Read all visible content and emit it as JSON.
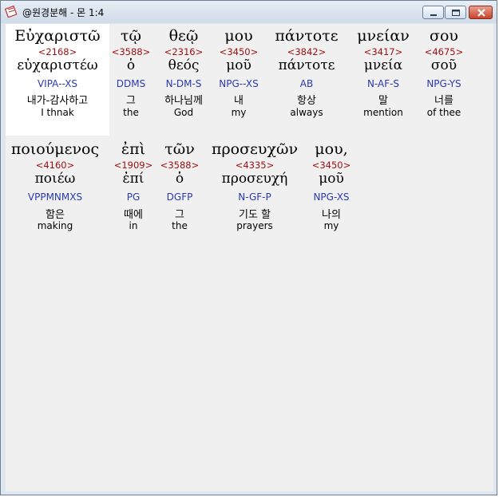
{
  "window": {
    "title": "@원경분해 - 몬 1:4",
    "icon": "bible-app-icon"
  },
  "rows": [
    [
      {
        "greek": "Εὐχαριστῶ",
        "number": "<2168>",
        "lemma": "εὐχαριστέω",
        "parsing": "VIPA--XS",
        "korean": "내가-감사하고",
        "english": "I thnak"
      },
      {
        "greek": "τῷ",
        "number": "<3588>",
        "lemma": "ὁ",
        "parsing": "DDMS",
        "korean": "그",
        "english": "the"
      },
      {
        "greek": "θεῷ",
        "number": "<2316>",
        "lemma": "θεός",
        "parsing": "N-DM-S",
        "korean": "하나님께",
        "english": "God"
      },
      {
        "greek": "μου",
        "number": "<3450>",
        "lemma": "μοῦ",
        "parsing": "NPG--XS",
        "korean": "내",
        "english": "my"
      },
      {
        "greek": "πάντοτε",
        "number": "<3842>",
        "lemma": "πάντοτε",
        "parsing": "AB",
        "korean": "항상",
        "english": "always"
      },
      {
        "greek": "μνείαν",
        "number": "<3417>",
        "lemma": "μνεία",
        "parsing": "N-AF-S",
        "korean": "말",
        "english": "mention"
      },
      {
        "greek": "σου",
        "number": "<4675>",
        "lemma": "σοῦ",
        "parsing": "NPG-YS",
        "korean": "너를",
        "english": "of thee"
      }
    ],
    [
      {
        "greek": "ποιούμενος",
        "number": "<4160>",
        "lemma": "ποιέω",
        "parsing": "VPPMNMXS",
        "korean": "함은",
        "english": "making"
      },
      {
        "greek": "ἐπὶ",
        "number": "<1909>",
        "lemma": "ἐπί",
        "parsing": "PG",
        "korean": "때에",
        "english": "in"
      },
      {
        "greek": "τῶν",
        "number": "<3588>",
        "lemma": "ὁ",
        "parsing": "DGFP",
        "korean": "그",
        "english": "the"
      },
      {
        "greek": "προσευχῶν",
        "number": "<4335>",
        "lemma": "προσευχή",
        "parsing": "N-GF-P",
        "korean": "기도 할",
        "english": "prayers"
      },
      {
        "greek": "μου,",
        "number": "<3450>",
        "lemma": "μοῦ",
        "parsing": "NPG-XS",
        "korean": "나의",
        "english": "my"
      }
    ]
  ],
  "colors": {
    "strongs_number": "#a01010",
    "parsing": "#2a3ab0",
    "selection": "#ffffff",
    "background": "#f0f0f0"
  }
}
